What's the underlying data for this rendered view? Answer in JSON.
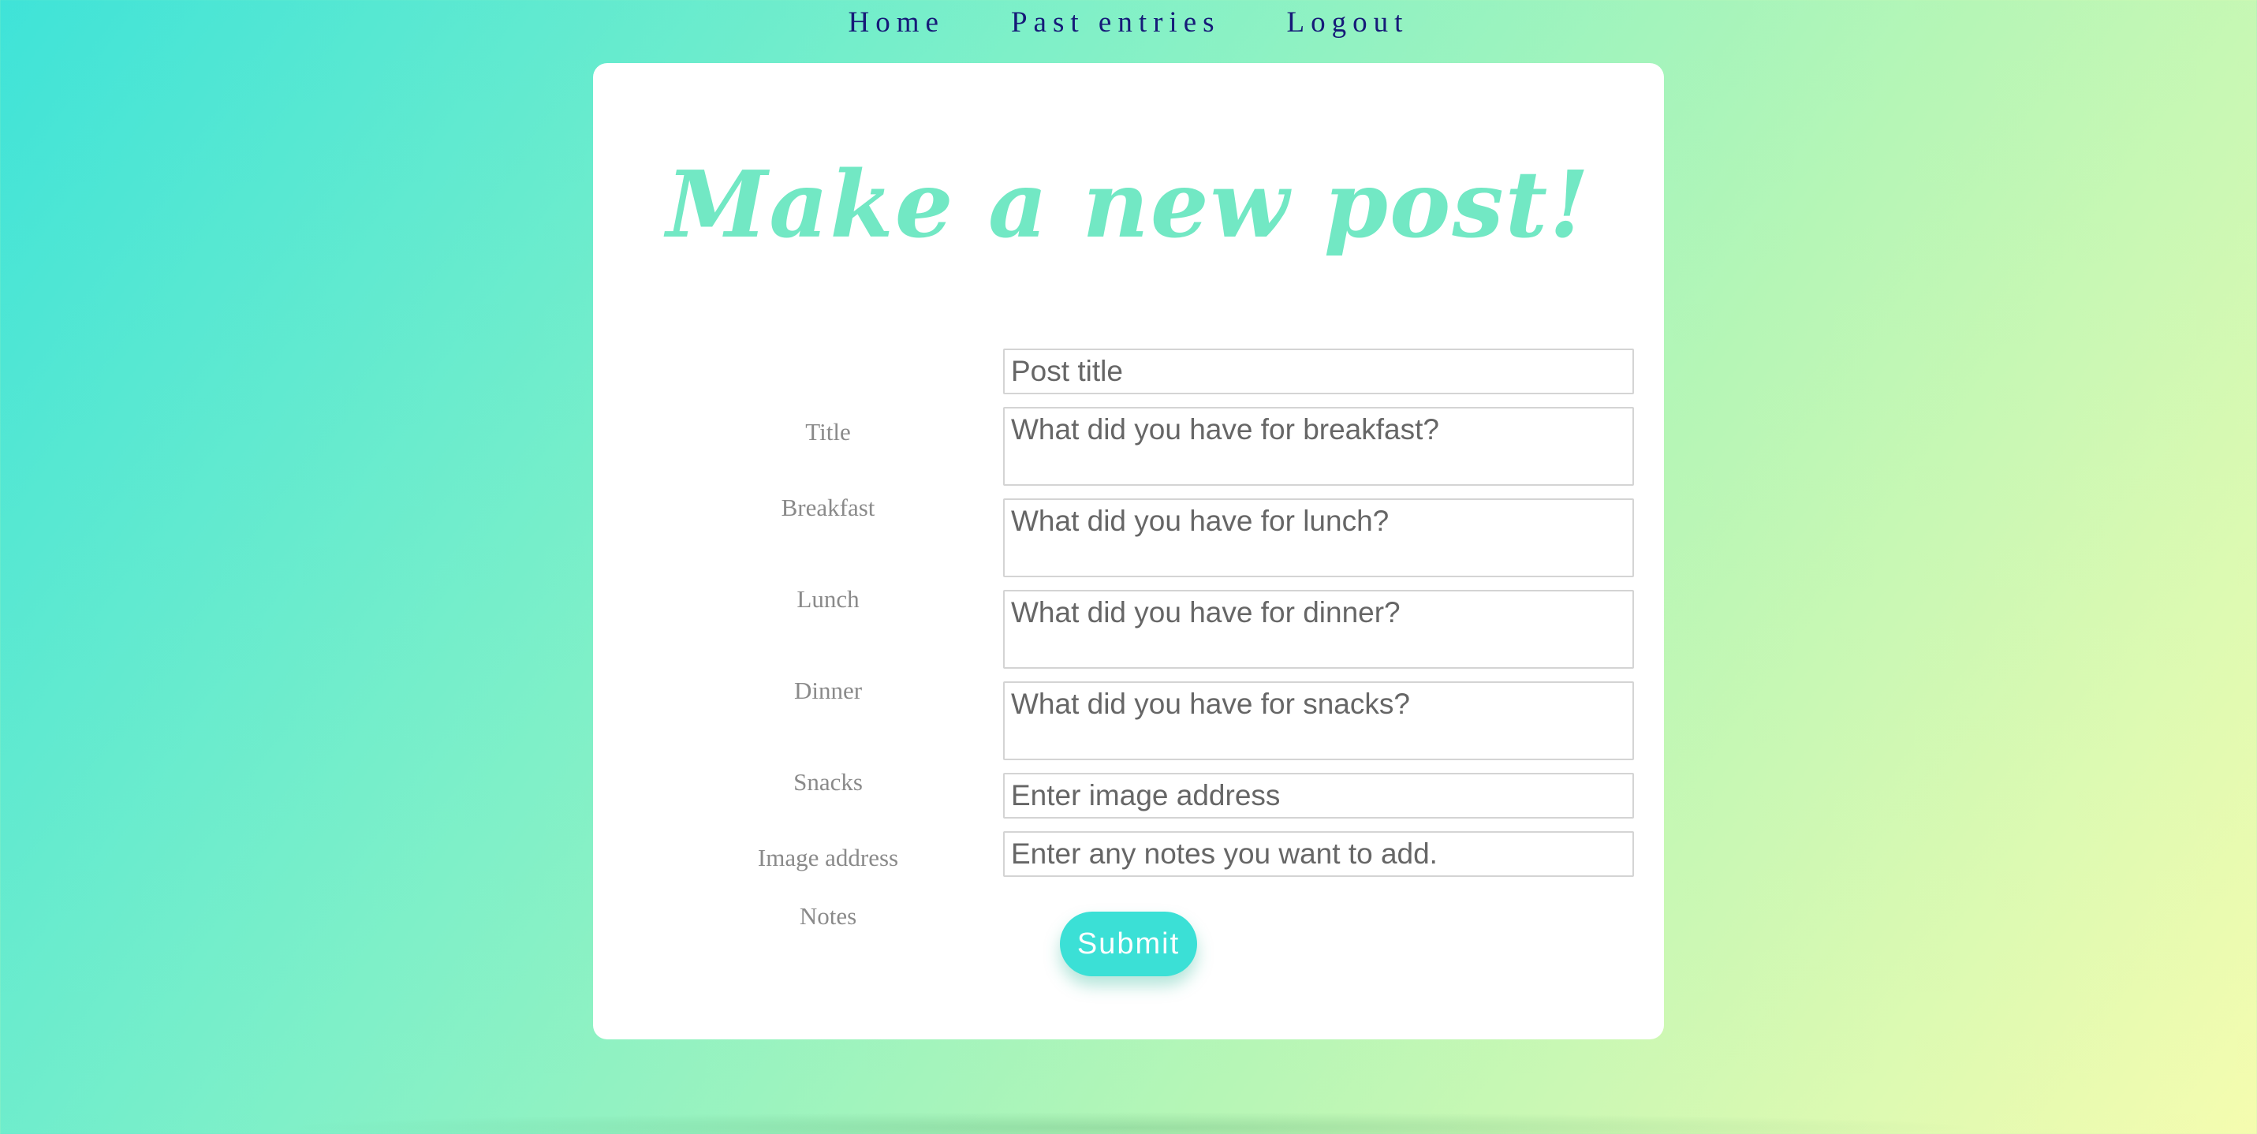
{
  "nav": {
    "items": [
      {
        "label": "Home"
      },
      {
        "label": "Past entries"
      },
      {
        "label": "Logout"
      }
    ]
  },
  "form": {
    "heading": "Make a new post!",
    "fields": {
      "title": {
        "label": "Title",
        "placeholder": "Post title"
      },
      "breakfast": {
        "label": "Breakfast",
        "placeholder": "What did you have for breakfast?"
      },
      "lunch": {
        "label": "Lunch",
        "placeholder": "What did you have for lunch?"
      },
      "dinner": {
        "label": "Dinner",
        "placeholder": "What did you have for dinner?"
      },
      "snacks": {
        "label": "Snacks",
        "placeholder": "What did you have for snacks?"
      },
      "image": {
        "label": "Image address",
        "placeholder": "Enter image address"
      },
      "notes": {
        "label": "Notes",
        "placeholder": "Enter any notes you want to add."
      }
    },
    "submit_label": "Submit"
  },
  "colors": {
    "heading": "#72e8c4",
    "nav_text": "#161a78",
    "submit_bg": "#3be0d6",
    "label_text": "#8a8a8a"
  }
}
